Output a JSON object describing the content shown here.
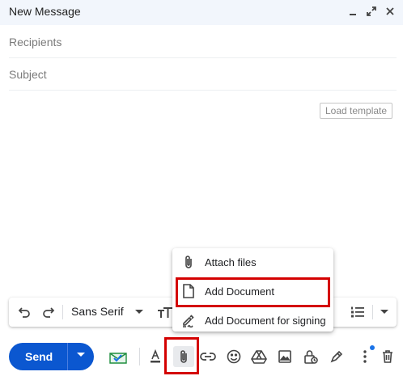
{
  "window": {
    "title": "New Message"
  },
  "header_icons": [
    "minimize-icon",
    "expand-icon",
    "close-icon"
  ],
  "fields": {
    "recipients_placeholder": "Recipients",
    "subject_placeholder": "Subject"
  },
  "load_template": "Load template",
  "format_bar": {
    "font": "Sans Serif",
    "tools": [
      "undo-icon",
      "redo-icon",
      "font-dropdown",
      "text-size-icon",
      "numbered-list-icon",
      "more-formatting-icon"
    ]
  },
  "attach_menu": {
    "items": [
      {
        "label": "Attach files",
        "icon": "paperclip-icon"
      },
      {
        "label": "Add Document",
        "icon": "document-icon"
      },
      {
        "label": "Add Document for signing",
        "icon": "signature-icon"
      }
    ]
  },
  "send": {
    "label": "Send"
  },
  "bottom_toolbar": [
    "mail-merge-icon",
    "text-color-icon",
    "attach-icon",
    "link-icon",
    "emoji-icon",
    "drive-icon",
    "photo-icon",
    "confidential-icon",
    "signature-pen-icon",
    "more-options-icon",
    "trash-icon"
  ],
  "colors": {
    "send": "#0b57d0",
    "highlight": "#d40000",
    "header_bg": "#f2f6fc",
    "notify_dot": "#1a73e8"
  }
}
